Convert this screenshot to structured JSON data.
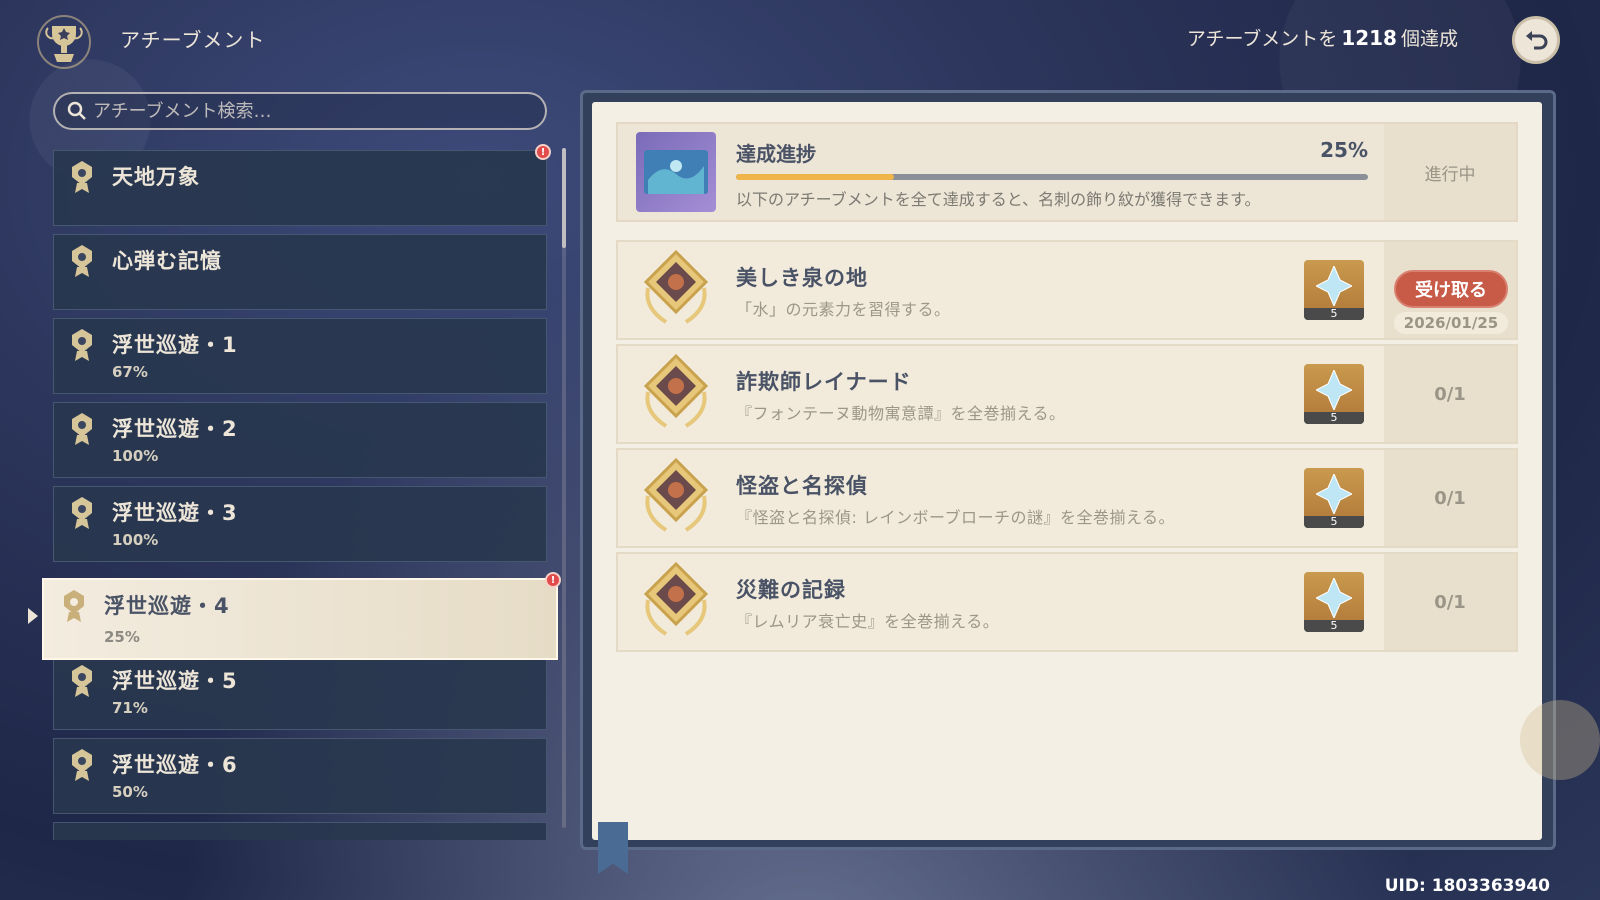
{
  "header": {
    "title": "アチーブメント",
    "count_prefix": "アチーブメントを",
    "count": "1218",
    "count_suffix": "個達成"
  },
  "search": {
    "placeholder": "アチーブメント検索…"
  },
  "categories": [
    {
      "name": "天地万象",
      "pct": "",
      "alert": true
    },
    {
      "name": "心弾む記憶",
      "pct": "",
      "alert": false
    },
    {
      "name": "浮世巡遊・1",
      "pct": "67%",
      "alert": false
    },
    {
      "name": "浮世巡遊・2",
      "pct": "100%",
      "alert": false
    },
    {
      "name": "浮世巡遊・3",
      "pct": "100%",
      "alert": false
    },
    {
      "name": "浮世巡遊・4",
      "pct": "25%",
      "alert": true,
      "active": true
    },
    {
      "name": "浮世巡遊・5",
      "pct": "71%",
      "alert": false
    },
    {
      "name": "浮世巡遊・6",
      "pct": "50%",
      "alert": false
    }
  ],
  "progress": {
    "title": "達成進捗",
    "percent_label": "25%",
    "percent_value": 0.25,
    "description": "以下のアチーブメントを全て達成すると、名刺の飾り紋が獲得できます。",
    "status": "進行中"
  },
  "achievements": [
    {
      "title": "美しき泉の地",
      "desc": "「水」の元素力を習得する。",
      "reward_qty": "5",
      "claim_label": "受け取る",
      "date": "2026/01/25"
    },
    {
      "title": "詐欺師レイナード",
      "desc": "『フォンテーヌ動物寓意譚』を全巻揃える。",
      "reward_qty": "5",
      "status": "0/1"
    },
    {
      "title": "怪盗と名探偵",
      "desc": "『怪盗と名探偵: レインボーブローチの謎』を全巻揃える。",
      "reward_qty": "5",
      "status": "0/1"
    },
    {
      "title": "災難の記録",
      "desc": "『レムリア衰亡史』を全巻揃える。",
      "reward_qty": "5",
      "status": "0/1"
    }
  ],
  "uid": "UID: 1803363940",
  "colors": {
    "accent_gold": "#f0b54a",
    "claim_red": "#c85a48",
    "panel_dark": "#28374e",
    "page_cream": "#f4efe5"
  },
  "icons": [
    "trophy-emblem-icon",
    "back-arrow-icon",
    "search-icon",
    "category-badge-icon",
    "medal-icon",
    "primogem-icon",
    "alert-icon"
  ]
}
